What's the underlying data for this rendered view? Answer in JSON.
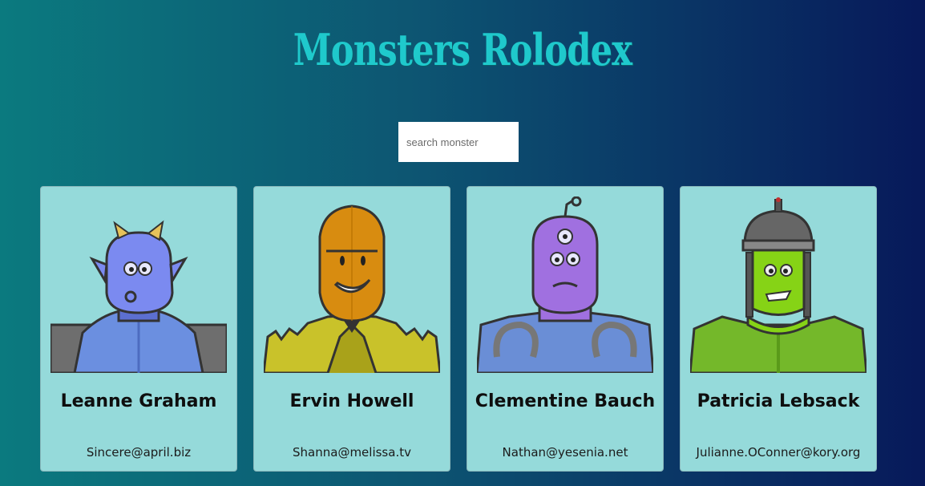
{
  "app": {
    "title": "Monsters Rolodex"
  },
  "search": {
    "placeholder": "search monster",
    "value": ""
  },
  "monsters": [
    {
      "name": "Leanne Graham",
      "email": "Sincere@april.biz",
      "image_icon": "blue-horned-monster-icon",
      "skin": "#7b8af0",
      "body": "#6b8fe0"
    },
    {
      "name": "Ervin Howell",
      "email": "Shanna@melissa.tv",
      "image_icon": "orange-smiling-monster-icon",
      "skin": "#d88c10",
      "body": "#c9c22a"
    },
    {
      "name": "Clementine Bauch",
      "email": "Nathan@yesenia.net",
      "image_icon": "purple-cyclops-robot-icon",
      "skin": "#a070e0",
      "body": "#6a8ed6"
    },
    {
      "name": "Patricia Lebsack",
      "email": "Julianne.OConner@kory.org",
      "image_icon": "green-frankenstein-monster-icon",
      "skin": "#86d316",
      "body": "#74b82a"
    }
  ],
  "colors": {
    "title": "#1fc9cc",
    "card_background": "#95dada",
    "gradient_left": "#0b7a7f",
    "gradient_right": "#07195a"
  }
}
